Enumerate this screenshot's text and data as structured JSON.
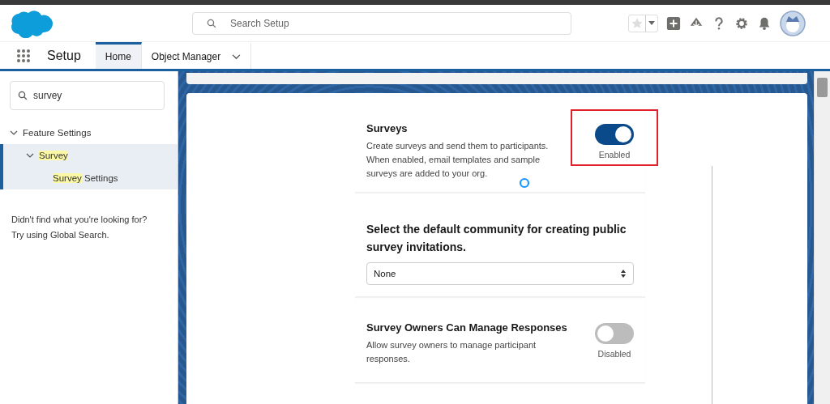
{
  "header": {
    "search": {
      "placeholder": "Search Setup"
    }
  },
  "nav": {
    "app_name": "Setup",
    "tabs": [
      {
        "label": "Home",
        "selected": true
      },
      {
        "label": "Object Manager",
        "selected": false
      }
    ]
  },
  "sidebar": {
    "search": {
      "value": "survey"
    },
    "tree": [
      {
        "rest": "Feature Settings",
        "expanded": true,
        "selected": false,
        "children": [
          {
            "match": "Survey",
            "expanded": true,
            "selected": true,
            "children": [
              {
                "match": "Survey",
                "rest": " Settings",
                "selected": true
              }
            ]
          }
        ]
      }
    ],
    "help_lines": [
      "Didn't find what you're looking for?",
      "Try using Global Search."
    ]
  },
  "settings": [
    {
      "kind": "toggle",
      "title": "Surveys",
      "description": "Create surveys and send them to participants. When enabled, email templates and sample surveys are added to your org.",
      "on": true,
      "status": "Enabled",
      "highlighted": true,
      "loading": true
    },
    {
      "kind": "select",
      "title": "Select the default community for creating public survey invitations.",
      "value": "None"
    },
    {
      "kind": "toggle",
      "title": "Survey Owners Can Manage Responses",
      "description": "Allow survey owners to manage participant responses.",
      "on": false,
      "status": "Disabled",
      "highlighted": false,
      "loading": false
    }
  ]
}
